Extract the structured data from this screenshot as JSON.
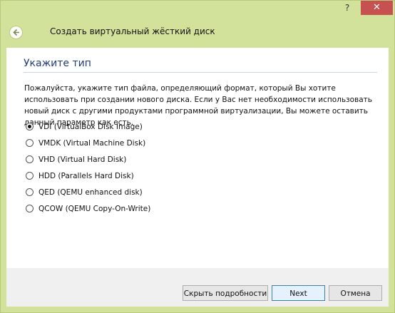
{
  "titlebar": {
    "help": "?",
    "close": "✕"
  },
  "header": {
    "title": "Создать виртуальный жёсткий диск",
    "back_icon": "back-arrow-icon"
  },
  "content": {
    "section_title": "Укажите тип",
    "description": "Пожалуйста, укажите тип файла, определяющий формат, который Вы хотите использовать при создании нового диска. Если у Вас нет необходимости использовать новый диск с другими продуктами программной виртуализации, Вы можете оставить данный параметр как есть.",
    "options": [
      {
        "label": "VDI (VirtualBox Disk Image)",
        "checked": true
      },
      {
        "label": "VMDK (Virtual Machine Disk)",
        "checked": false
      },
      {
        "label": "VHD (Virtual Hard Disk)",
        "checked": false
      },
      {
        "label": "HDD (Parallels Hard Disk)",
        "checked": false
      },
      {
        "label": "QED (QEMU enhanced disk)",
        "checked": false
      },
      {
        "label": "QCOW (QEMU Copy-On-Write)",
        "checked": false
      }
    ]
  },
  "footer": {
    "details_label": "Скрыть подробности",
    "next_label": "Next",
    "cancel_label": "Отмена"
  },
  "colors": {
    "frame": "#d3e29a",
    "close": "#c75050",
    "accent_title": "#1f3d7a"
  }
}
